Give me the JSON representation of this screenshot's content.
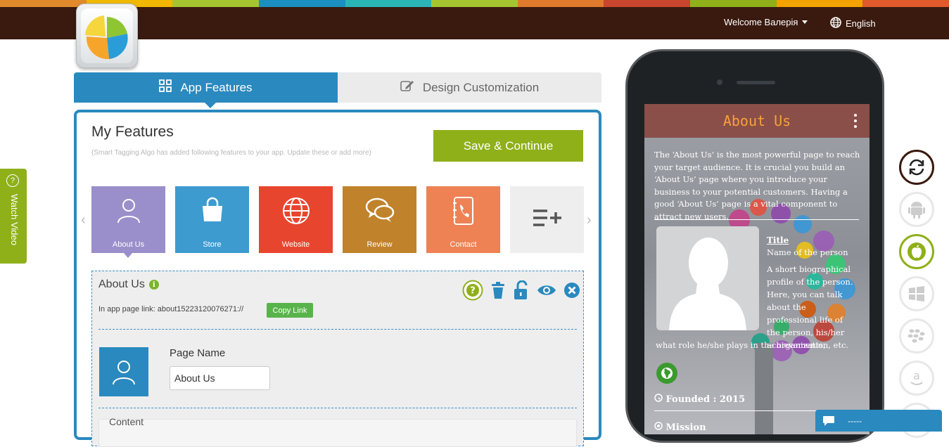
{
  "header": {
    "stripe_colors": [
      "#e08a2c",
      "#f0b800",
      "#a5c530",
      "#1a8fc0",
      "#2ab5b5",
      "#e07a2c",
      "#c8452e",
      "#8fb019",
      "#f2a300",
      "#e05a2c"
    ],
    "welcome": "Welcome Валерія",
    "language": "English",
    "icons": [
      "caret-down-icon",
      "globe-icon"
    ]
  },
  "tabs": [
    {
      "label": "App Features",
      "icon": "grid-icon",
      "active": true
    },
    {
      "label": "Design Customization",
      "icon": "edit-icon",
      "active": false
    }
  ],
  "features_panel": {
    "title": "My Features",
    "subtitle": "(Smart Tagging Algo has added following features to your app. Update these or add more)",
    "save_button": "Save & Continue",
    "features": [
      {
        "label": "About Us",
        "icon": "user-icon",
        "color": "#9b8fcb"
      },
      {
        "label": "Store",
        "icon": "shopping-bag-icon",
        "color": "#3d9bd0"
      },
      {
        "label": "Website",
        "icon": "globe-icon",
        "color": "#e8452f"
      },
      {
        "label": "Review",
        "icon": "chat-bubbles-icon",
        "color": "#c0822b"
      },
      {
        "label": "Contact",
        "icon": "address-book-icon",
        "color": "#ee8255"
      },
      {
        "label": "",
        "icon": "add-list-icon",
        "color": "#eeeeee"
      }
    ]
  },
  "editor": {
    "title": "About Us",
    "page_link_label": "In app page link: about15223120076271://",
    "copy_link": "Copy Link",
    "page_name_label": "Page Name",
    "page_name_value": "About Us",
    "content_label": "Content"
  },
  "watch_video": "Watch Video",
  "phone": {
    "app_title": "About Us",
    "intro": "The ‘About Us’ is the most powerful page to reach your target audience. It is crucial you build an ‘About Us’ page where you introduce your business to your potential customers. Having a good ‘About Us’ page is a vital component to attract new users.",
    "person_title": "Title",
    "person_name": "Name of the person",
    "bio": "A short biographical profile of the person. Here, you can talk about the professional life of the person, his/her achievements,",
    "bio_tail": "what role he/she plays in the organization, etc.",
    "founded": "Founded : 2015",
    "mission": "Mission"
  },
  "platforms": [
    "refresh-icon",
    "android-icon",
    "apple-icon",
    "windows-icon",
    "blackberry-icon",
    "amazon-icon"
  ],
  "chat_bar": "-----"
}
